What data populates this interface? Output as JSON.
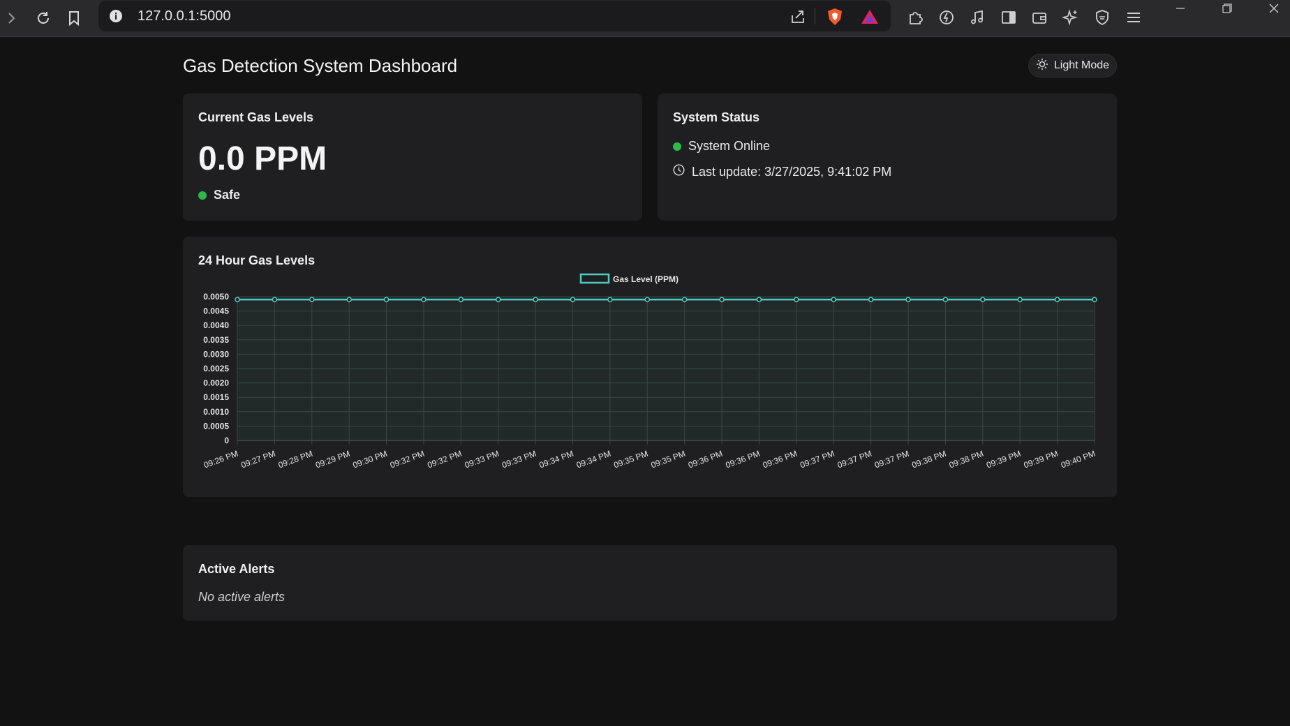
{
  "browser": {
    "url": "127.0.0.1:5000",
    "icons": [
      "forward-icon",
      "reload-icon",
      "bookmark-icon",
      "info-icon",
      "share-icon",
      "brave-shield-icon",
      "brave-rewards-icon",
      "extensions-icon",
      "leo-icon",
      "music-icon",
      "sidebar-icon",
      "wallet-icon",
      "ai-icon",
      "vpn-icon",
      "menu-icon",
      "minimize-icon",
      "restore-icon",
      "close-icon"
    ]
  },
  "header": {
    "title": "Gas Detection System Dashboard",
    "theme_toggle_label": "Light Mode",
    "theme_toggle_icon": "sun-icon"
  },
  "current_levels": {
    "title": "Current Gas Levels",
    "value": "0.0 PPM",
    "status": "Safe",
    "status_color": "#2eb84a"
  },
  "system_status": {
    "title": "System Status",
    "online_text": "System Online",
    "online_color": "#2eb84a",
    "last_update": "Last update: 3/27/2025, 9:41:02 PM",
    "clock_icon": "clock-icon"
  },
  "chart_section": {
    "title": "24 Hour Gas Levels"
  },
  "chart_data": {
    "type": "line",
    "title": "",
    "xlabel": "",
    "ylabel": "",
    "series": [
      {
        "name": "Gas Level (PPM)",
        "color": "#4ecdc4",
        "values": [
          0.0049,
          0.0049,
          0.0049,
          0.0049,
          0.0049,
          0.0049,
          0.0049,
          0.0049,
          0.0049,
          0.0049,
          0.0049,
          0.0049,
          0.0049,
          0.0049,
          0.0049,
          0.0049,
          0.0049,
          0.0049,
          0.0049,
          0.0049,
          0.0049,
          0.0049,
          0.0049,
          0.0049
        ]
      }
    ],
    "x": [
      "09:26 PM",
      "09:27 PM",
      "09:28 PM",
      "09:29 PM",
      "09:30 PM",
      "09:32 PM",
      "09:32 PM",
      "09:33 PM",
      "09:33 PM",
      "09:34 PM",
      "09:34 PM",
      "09:35 PM",
      "09:35 PM",
      "09:36 PM",
      "09:36 PM",
      "09:36 PM",
      "09:37 PM",
      "09:37 PM",
      "09:37 PM",
      "09:38 PM",
      "09:38 PM",
      "09:39 PM",
      "09:39 PM",
      "09:40 PM"
    ],
    "yticks": [
      "0",
      "0.0005",
      "0.0010",
      "0.0015",
      "0.0020",
      "0.0025",
      "0.0030",
      "0.0035",
      "0.0040",
      "0.0045",
      "0.0050"
    ],
    "ylim": [
      0,
      0.005
    ],
    "grid": true,
    "legend": "top-center",
    "fill": true
  },
  "alerts": {
    "title": "Active Alerts",
    "empty_text": "No active alerts"
  }
}
